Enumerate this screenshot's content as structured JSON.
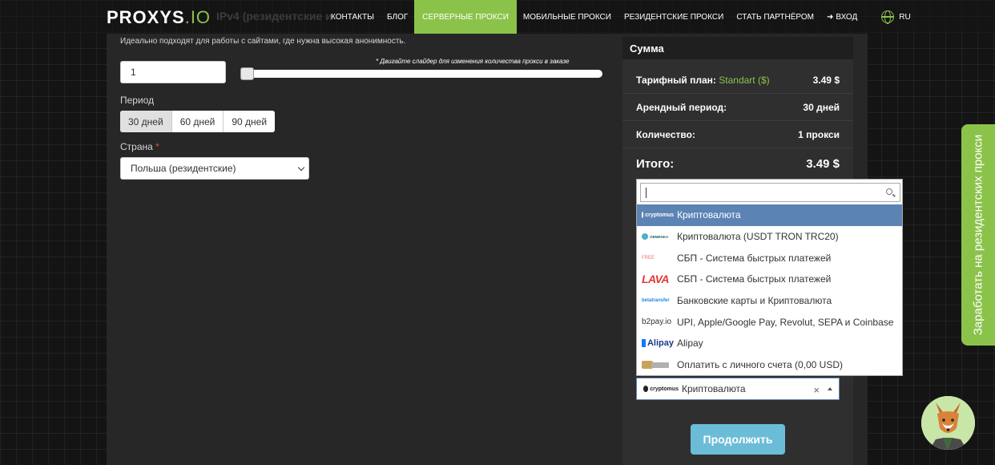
{
  "header": {
    "logo_main": "PROXYS",
    "logo_suffix": ".IO",
    "ghost_title": "IPv4 (резидентские и",
    "nav": {
      "contacts": "КОНТАКТЫ",
      "blog": "БЛОГ",
      "server_proxies": "СЕРВЕРНЫЕ ПРОКСИ",
      "mobile_proxies": "МОБИЛЬНЫЕ ПРОКСИ",
      "residential_proxies": "РЕЗИДЕНТСКИЕ ПРОКСИ",
      "partner": "СТАТЬ ПАРТНЁРОМ",
      "login": "ВХОД",
      "lang": "RU"
    }
  },
  "form": {
    "description": "Идеально подходят для работы с сайтами, где нужна высокая анонимность.",
    "quantity_value": "1",
    "slider_hint": "* Двигайте слайдер для изменения количества прокси в заказе",
    "period_label": "Период",
    "periods": [
      "30 дней",
      "60 дней",
      "90 дней"
    ],
    "country_label": "Страна",
    "required_mark": "*",
    "country_value": "Польша (резидентские)"
  },
  "summary": {
    "title": "Сумма",
    "plan_label": "Тарифный план:",
    "plan_name": "Standart ($)",
    "plan_price": "3.49 $",
    "period_label": "Арендный период:",
    "period_value": "30 дней",
    "qty_label": "Количество:",
    "qty_value": "1 прокси",
    "total_label": "Итого:",
    "total_value": "3.49 $"
  },
  "payment": {
    "options": [
      {
        "logo": "cryptomus",
        "label": "Криптовалюта",
        "active": true
      },
      {
        "logo": "OBMENKA",
        "label": "Криптовалюта (USDT TRON TRC20)"
      },
      {
        "logo": "FREE",
        "label": "СБП - Система быстрых платежей"
      },
      {
        "logo": "LAVA",
        "label": "СБП - Система быстрых платежей"
      },
      {
        "logo": "betatransfer",
        "label": "Банковские карты и Криптовалюта"
      },
      {
        "logo": "b2pay.io",
        "label": "UPI, Apple/Google Pay, Revolut, SEPA и Coinbase"
      },
      {
        "logo": "Alipay",
        "label": "Alipay"
      },
      {
        "logo": "wallet",
        "label": "Оплатить с личного счета (0,00 USD)"
      }
    ],
    "selected_logo": "cryptomus",
    "selected_label": "Криптовалюта",
    "clear": "×",
    "continue_label": "Продолжить"
  },
  "side_tab": "Заработать на резидентских прокси",
  "colors": {
    "accent": "#8bc34a",
    "highlight": "#5b84b5",
    "button": "#6bbcd7",
    "required": "#e74c3c"
  }
}
